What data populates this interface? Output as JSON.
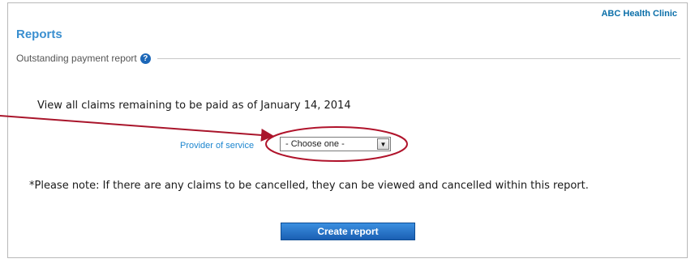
{
  "header": {
    "clinic_name": "ABC Health Clinic",
    "page_title": "Reports"
  },
  "section": {
    "title": "Outstanding payment report",
    "help_icon_glyph": "?"
  },
  "main": {
    "intro_text": "View all claims remaining to be paid as of January 14, 2014",
    "provider_label": "Provider of service",
    "provider_select_value": "- Choose one -",
    "note_text": "*Please note: If there are any claims to be cancelled, they can be viewed and cancelled within this report.",
    "create_button_label": "Create report"
  },
  "icons": {
    "help": "help-icon",
    "dropdown": "chevron-down-icon"
  },
  "colors": {
    "accent_blue": "#3a8fd0",
    "label_blue": "#1d86cf",
    "button_blue": "#1b5fb3",
    "annotation_red": "#a9152b"
  }
}
